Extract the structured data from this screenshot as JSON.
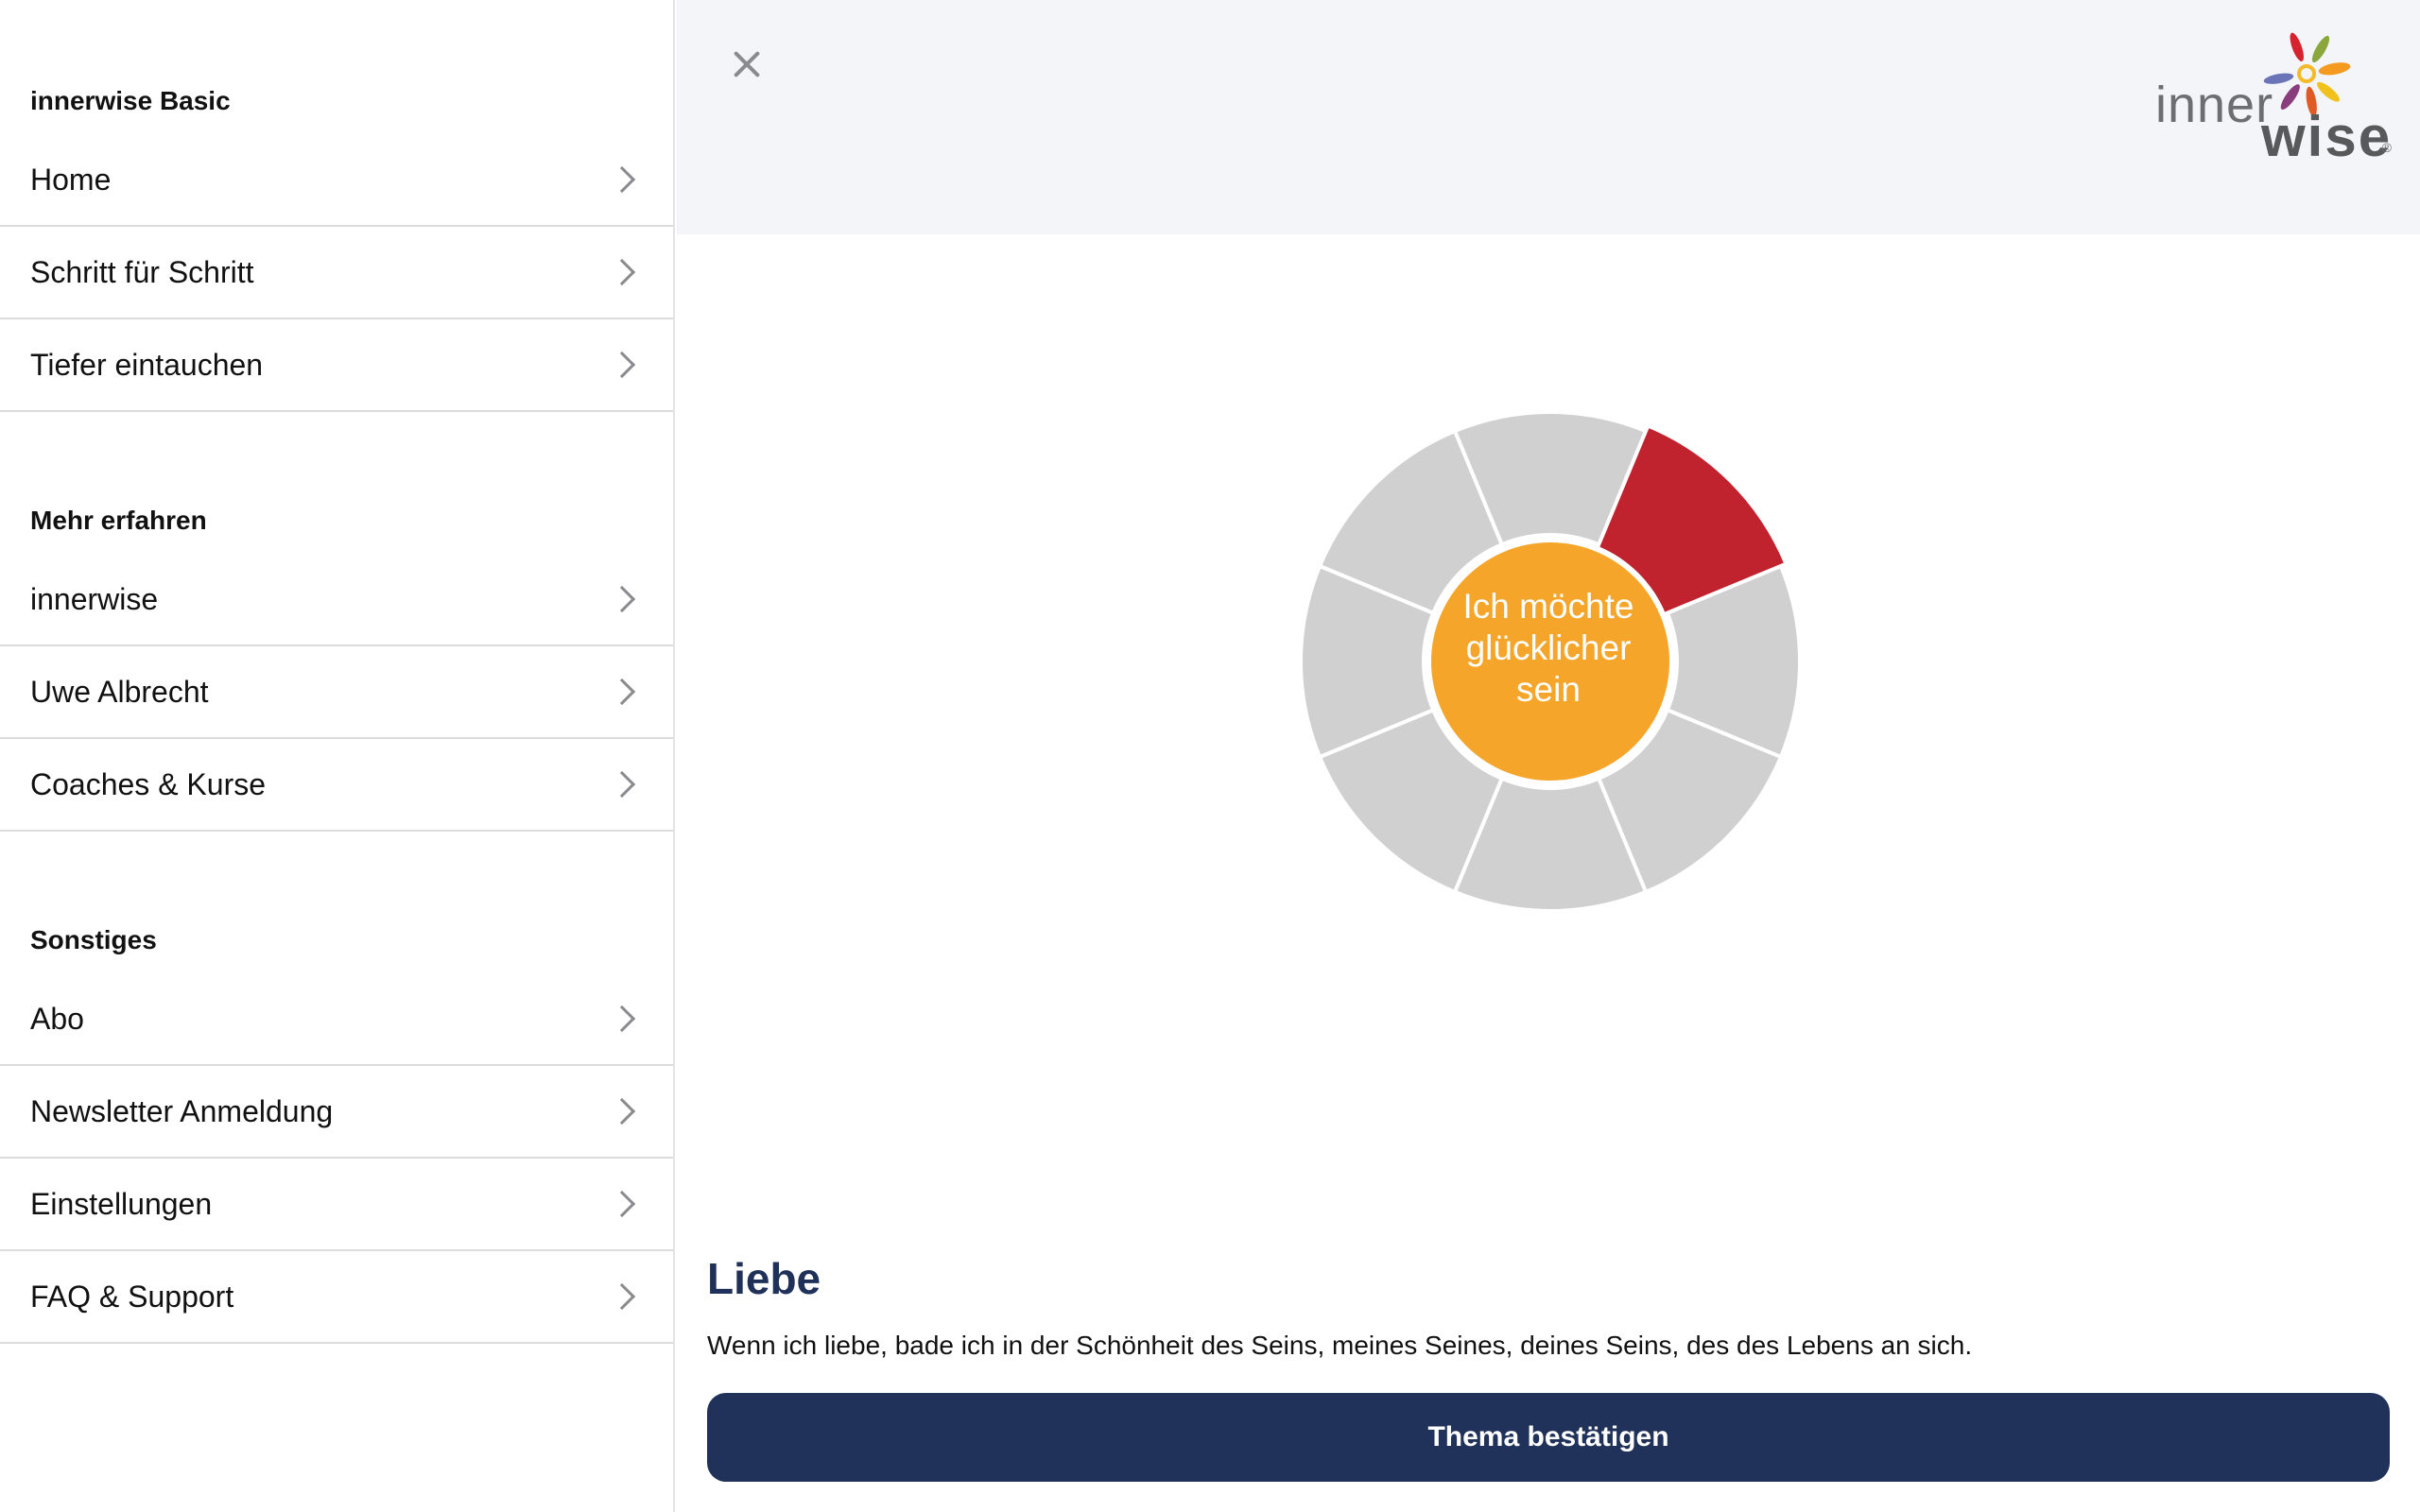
{
  "sidebar": {
    "sections": [
      {
        "title": "innerwise Basic",
        "items": [
          "Home",
          "Schritt für Schritt",
          "Tiefer eintauchen"
        ]
      },
      {
        "title": "Mehr erfahren",
        "items": [
          "innerwise",
          "Uwe Albrecht",
          "Coaches & Kurse"
        ]
      },
      {
        "title": "Sonstiges",
        "items": [
          "Abo",
          "Newsletter Anmeldung",
          "Einstellungen",
          "FAQ & Support"
        ]
      }
    ]
  },
  "header": {
    "close_icon": "close-icon",
    "logo": {
      "text_inner": "inner",
      "text_wise": "wise",
      "reg": "®"
    }
  },
  "wheel": {
    "segments": 8,
    "selected_index": 1,
    "center_lines": [
      "Ich möchte",
      "glücklicher",
      "sein"
    ],
    "colors": {
      "segment": "#d0d0d0",
      "selected": "#c0222e",
      "center": "#f5a62a",
      "gap": "#ffffff"
    }
  },
  "topic": {
    "title": "Liebe",
    "description": "Wenn ich liebe, bade ich in der Schönheit des Seins, meines Seines, deines Seins, des des Lebens an sich."
  },
  "actions": {
    "confirm_label": "Thema bestätigen"
  }
}
